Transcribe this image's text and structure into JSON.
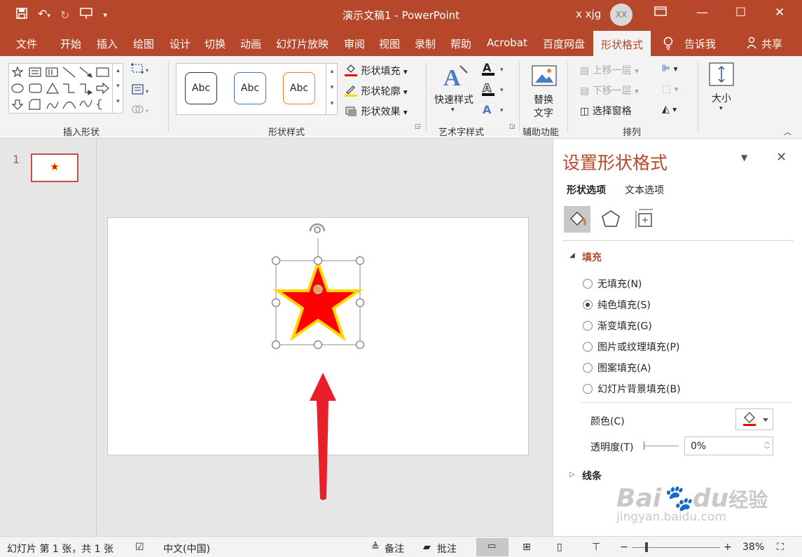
{
  "window": {
    "title": "演示文稿1 - PowerPoint",
    "user": "x xjg",
    "avatar": "XX"
  },
  "tabs": [
    "文件",
    "开始",
    "插入",
    "绘图",
    "设计",
    "切换",
    "动画",
    "幻灯片放映",
    "审阅",
    "视图",
    "录制",
    "帮助",
    "Acrobat",
    "百度网盘",
    "形状格式"
  ],
  "active_tab": "形状格式",
  "tell_me": "告诉我",
  "share": "共享",
  "ribbon": {
    "insert_shapes_label": "插入形状",
    "shape_styles_label": "形状样式",
    "style_samples": [
      "Abc",
      "Abc",
      "Abc"
    ],
    "shape_fill": "形状填充",
    "shape_outline": "形状轮廓",
    "shape_effects": "形状效果",
    "quick_styles": "快速样式",
    "art_text_label": "艺术字样式",
    "alt_text": "替换\n文字",
    "alt_text_1": "替换",
    "alt_text_2": "文字",
    "accessibility_label": "辅助功能",
    "bring_forward": "上移一层",
    "send_backward": "下移一层",
    "selection_pane": "选择窗格",
    "arrange_label": "排列",
    "size": "大小"
  },
  "thumbnails": [
    {
      "number": "1"
    }
  ],
  "format_pane": {
    "title": "设置形状格式",
    "tab_shape": "形状选项",
    "tab_text": "文本选项",
    "fill_section": "填充",
    "fill_options": [
      {
        "label": "无填充(N)",
        "selected": false
      },
      {
        "label": "纯色填充(S)",
        "selected": true
      },
      {
        "label": "渐变填充(G)",
        "selected": false
      },
      {
        "label": "图片或纹理填充(P)",
        "selected": false
      },
      {
        "label": "图案填充(A)",
        "selected": false
      },
      {
        "label": "幻灯片背景填充(B)",
        "selected": false
      }
    ],
    "color_label": "颜色(C)",
    "transparency_label": "透明度(T)",
    "transparency_value": "0%",
    "line_section": "线条"
  },
  "status": {
    "slide_info": "幻灯片 第 1 张，共 1 张",
    "language": "中文(中国)",
    "notes": "备注",
    "comments": "批注",
    "zoom": "38%"
  },
  "watermark": {
    "brand": "Bai",
    "brand2": "du",
    "cn": "经验",
    "url": "jingyan.baidu.com"
  },
  "colors": {
    "accent": "#b7472a",
    "star_fill": "#ff0000",
    "star_outline": "#ffd700",
    "arrow": "#e8202a"
  }
}
